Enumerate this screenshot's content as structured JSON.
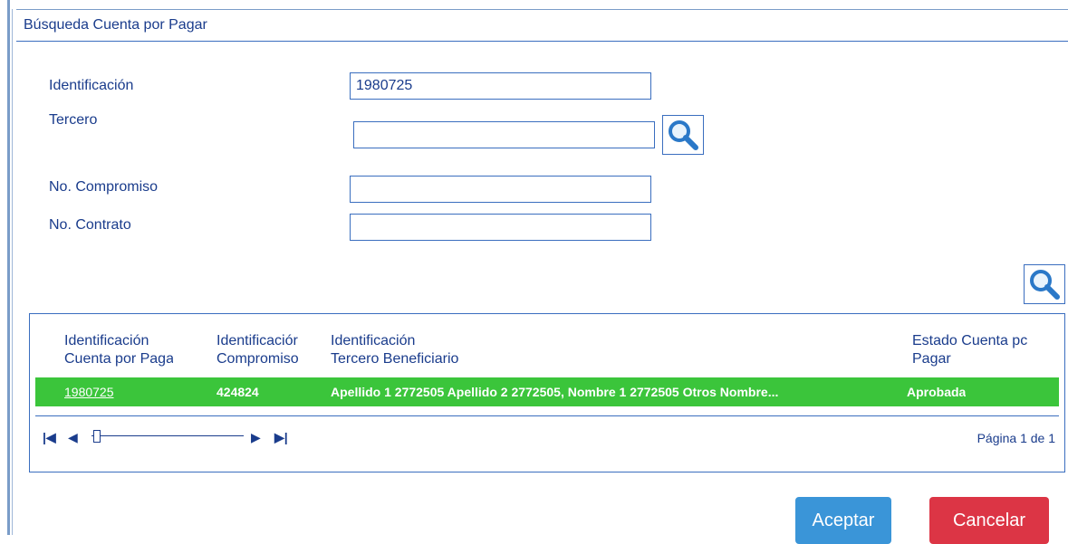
{
  "dialog": {
    "title": "Búsqueda Cuenta por Pagar"
  },
  "form": {
    "identificacion_label": "Identificación",
    "identificacion_value": "1980725",
    "tercero_label": "Tercero",
    "tercero_value": "",
    "compromiso_label": "No. Compromiso",
    "compromiso_value": "",
    "contrato_label": "No. Contrato",
    "contrato_value": ""
  },
  "grid": {
    "columns": [
      {
        "line1": "Identificación",
        "line2": "Cuenta por Paga"
      },
      {
        "line1": "Identificaciór",
        "line2": "Compromiso"
      },
      {
        "line1": "Identificación",
        "line2": "Tercero Beneficiario"
      },
      {
        "line1": "Estado Cuenta pc",
        "line2": "Pagar"
      }
    ],
    "rows": [
      {
        "cuenta": "1980725",
        "compromiso": "424824",
        "tercero": "Apellido 1 2772505 Apellido 2 2772505, Nombre 1 2772505 Otros Nombre...",
        "estado": "Aprobada"
      }
    ],
    "pager": {
      "page_text": "Página 1 de 1"
    }
  },
  "buttons": {
    "accept": "Aceptar",
    "cancel": "Cancelar"
  },
  "colors": {
    "selected_row": "#3bc53b",
    "accept": "#3a95d8",
    "cancel": "#dc3545",
    "text": "#1a3c8c",
    "border": "#3a6ebf"
  },
  "icons": {
    "tercero_search": "magnifier-icon",
    "main_search": "magnifier-icon",
    "pager": [
      "first-page-icon",
      "prev-page-icon",
      "next-page-icon",
      "last-page-icon"
    ]
  }
}
